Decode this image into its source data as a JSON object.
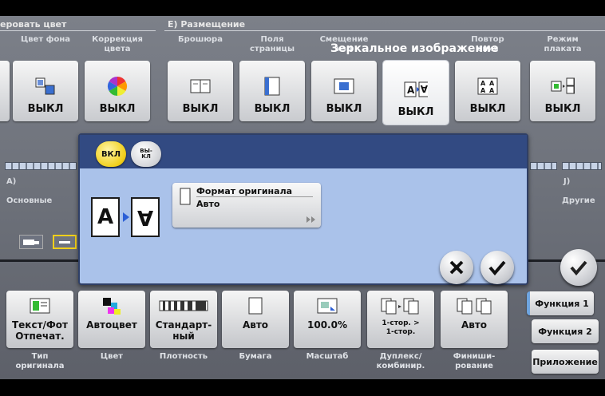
{
  "top_sections": {
    "color_adjust_header": "еровать цвет",
    "layout_header": "E)  Размещение"
  },
  "function_buttons": [
    {
      "label_line1": "",
      "label_line2": "Цвет фона",
      "value": "ВЫКЛ"
    },
    {
      "label_line1": "Коррекция",
      "label_line2": "цвета",
      "value": "ВЫКЛ"
    },
    {
      "label_line1": "",
      "label_line2": "Брошюра",
      "value": "ВЫКЛ"
    },
    {
      "label_line1": "Поля",
      "label_line2": "страницы",
      "value": "ВЫКЛ"
    },
    {
      "label_line1": "Смещение",
      "label_line2": "изо",
      "value": "ВЫКЛ"
    },
    {
      "label_line1": "",
      "label_line2": "",
      "value": "ВЫКЛ"
    },
    {
      "label_line1": "Повтор",
      "label_line2": "ения",
      "value": "ВЫКЛ"
    },
    {
      "label_line1": "Режим",
      "label_line2": "плаката",
      "value": "ВЫКЛ"
    }
  ],
  "active_function_title": "Зеркальное изображение",
  "side_labels": {
    "left_tab": "A)",
    "left_name": "Основные",
    "right_tab": "J)",
    "right_name": "Другие"
  },
  "dialog": {
    "on_label": "ВКЛ",
    "off_label_line1": "ВЫ-",
    "off_label_line2": "КЛ",
    "mirror_left": "A",
    "mirror_right": "A",
    "original_format_title": "Формат оригинала",
    "original_format_value": "Авто"
  },
  "bottom_buttons": [
    {
      "value": "Текст/Фот\nОтпечат.",
      "label": "Тип\nоригинала"
    },
    {
      "value": "Автоцвет",
      "label": "Цвет"
    },
    {
      "value": "Стандарт-\nный",
      "label": "Плотность"
    },
    {
      "value": "Авто",
      "label": "Бумага"
    },
    {
      "value": "100.0%",
      "label": "Масштаб"
    },
    {
      "value": "1-стор. >\n1-стор.",
      "label": "Дуплекс/\nкомбинир."
    },
    {
      "value": "Авто",
      "label": "Финиши-\nрование"
    }
  ],
  "right_tabs": {
    "function1": "Функция 1",
    "function2": "Функция 2",
    "application": "Приложение"
  },
  "colors": {
    "dialog_bg": "#aac2ea",
    "dialog_header": "#324a82",
    "on_pill": "#f1cf1a",
    "accent_blue": "#2c5fd6"
  }
}
